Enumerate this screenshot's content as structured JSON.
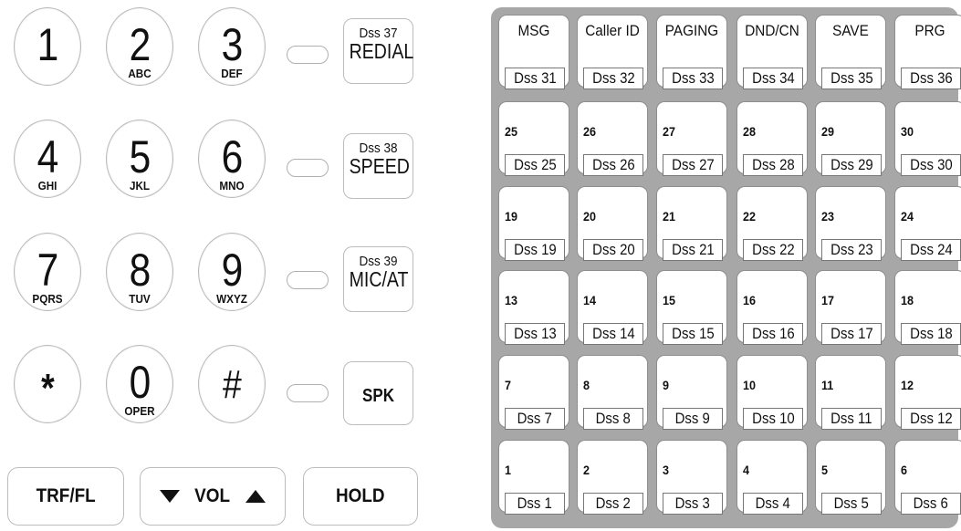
{
  "keypad": [
    {
      "digit": "1",
      "letters": ""
    },
    {
      "digit": "2",
      "letters": "ABC"
    },
    {
      "digit": "3",
      "letters": "DEF"
    },
    {
      "digit": "4",
      "letters": "GHI"
    },
    {
      "digit": "5",
      "letters": "JKL"
    },
    {
      "digit": "6",
      "letters": "MNO"
    },
    {
      "digit": "7",
      "letters": "PQRS"
    },
    {
      "digit": "8",
      "letters": "TUV"
    },
    {
      "digit": "9",
      "letters": "WXYZ"
    },
    {
      "digit": "*",
      "letters": ""
    },
    {
      "digit": "0",
      "letters": "OPER"
    },
    {
      "digit": "#",
      "letters": ""
    }
  ],
  "function_keys": [
    {
      "sub": "Dss 37",
      "main": "REDIAL"
    },
    {
      "sub": "Dss 38",
      "main": "SPEED"
    },
    {
      "sub": "Dss 39",
      "main": "MIC/AT"
    },
    {
      "sub": "",
      "main": "SPK"
    }
  ],
  "bottom_keys": {
    "transfer": "TRF/FL",
    "volume": "VOL",
    "hold": "HOLD"
  },
  "dss_keys": [
    {
      "top": "MSG",
      "tag": "Dss 31"
    },
    {
      "top": "Caller ID",
      "tag": "Dss 32"
    },
    {
      "top": "PAGING",
      "tag": "Dss 33"
    },
    {
      "top": "DND/CN",
      "tag": "Dss 34"
    },
    {
      "top": "SAVE",
      "tag": "Dss 35"
    },
    {
      "top": "PRG",
      "tag": "Dss 36"
    },
    {
      "top": "25",
      "tag": "Dss 25"
    },
    {
      "top": "26",
      "tag": "Dss 26"
    },
    {
      "top": "27",
      "tag": "Dss 27"
    },
    {
      "top": "28",
      "tag": "Dss 28"
    },
    {
      "top": "29",
      "tag": "Dss 29"
    },
    {
      "top": "30",
      "tag": "Dss 30"
    },
    {
      "top": "19",
      "tag": "Dss 19"
    },
    {
      "top": "20",
      "tag": "Dss 20"
    },
    {
      "top": "21",
      "tag": "Dss 21"
    },
    {
      "top": "22",
      "tag": "Dss 22"
    },
    {
      "top": "23",
      "tag": "Dss 23"
    },
    {
      "top": "24",
      "tag": "Dss 24"
    },
    {
      "top": "13",
      "tag": "Dss 13"
    },
    {
      "top": "14",
      "tag": "Dss 14"
    },
    {
      "top": "15",
      "tag": "Dss 15"
    },
    {
      "top": "16",
      "tag": "Dss 16"
    },
    {
      "top": "17",
      "tag": "Dss 17"
    },
    {
      "top": "18",
      "tag": "Dss 18"
    },
    {
      "top": "7",
      "tag": "Dss 7"
    },
    {
      "top": "8",
      "tag": "Dss 8"
    },
    {
      "top": "9",
      "tag": "Dss 9"
    },
    {
      "top": "10",
      "tag": "Dss 10"
    },
    {
      "top": "11",
      "tag": "Dss 11"
    },
    {
      "top": "12",
      "tag": "Dss 12"
    },
    {
      "top": "1",
      "tag": "Dss 1"
    },
    {
      "top": "2",
      "tag": "Dss 2"
    },
    {
      "top": "3",
      "tag": "Dss 3"
    },
    {
      "top": "4",
      "tag": "Dss 4"
    },
    {
      "top": "5",
      "tag": "Dss 5"
    },
    {
      "top": "6",
      "tag": "Dss 6"
    }
  ]
}
